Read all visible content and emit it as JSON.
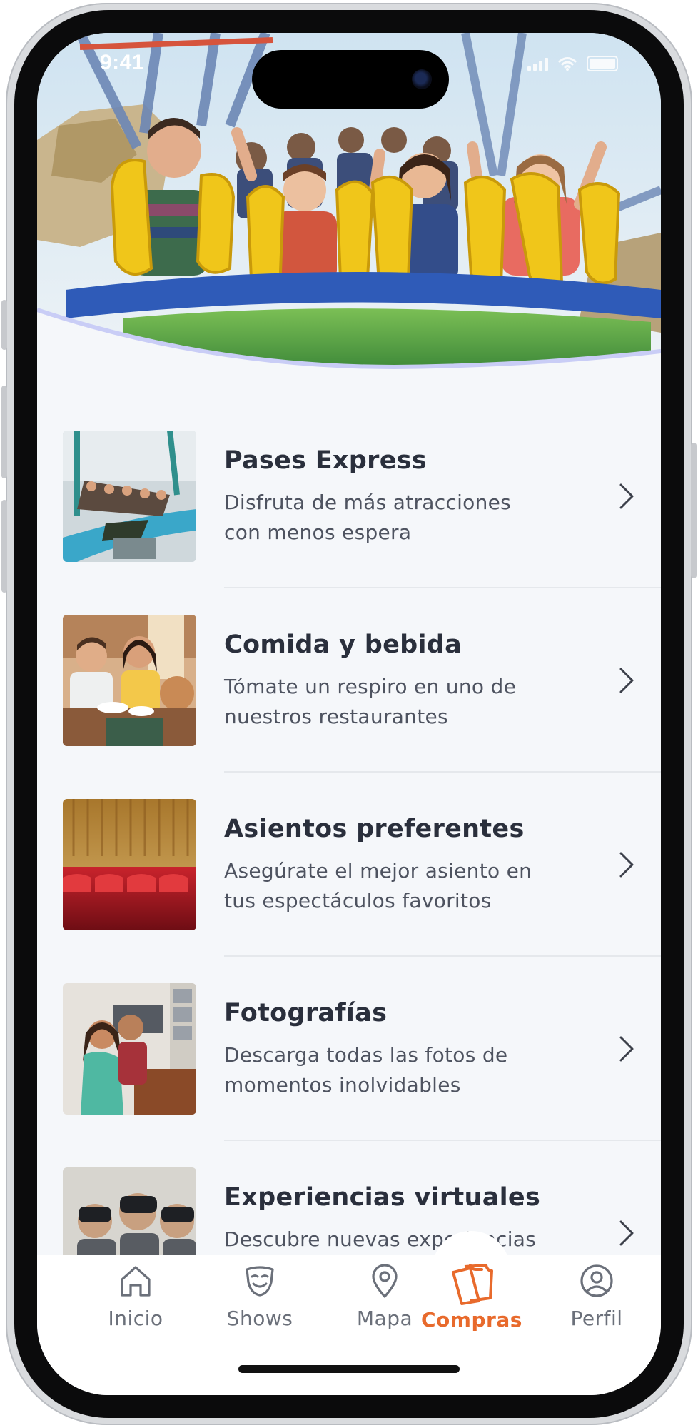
{
  "status_bar": {
    "time": "9:41"
  },
  "hero": {
    "image": "roller-coaster-riders-photo"
  },
  "items": [
    {
      "title": "Pases Express",
      "description": "Disfruta de más atracciones con menos espera",
      "thumb": "coaster-thumb"
    },
    {
      "title": "Comida y bebida",
      "description": "Tómate un respiro en uno de nuestros restaurantes",
      "thumb": "family-dinner-thumb"
    },
    {
      "title": "Asientos preferentes",
      "description": "Asegúrate el mejor asiento en tus espectáculos favoritos",
      "thumb": "theater-seats-thumb"
    },
    {
      "title": "Fotografías",
      "description": "Descarga todas las fotos de momentos inolvidables",
      "thumb": "photo-shop-thumb"
    },
    {
      "title": "Experiencias virtuales",
      "description": "Descubre nuevas experiencias",
      "thumb": "vr-headset-thumb"
    }
  ],
  "tabs": [
    {
      "label": "Inicio",
      "icon": "home-icon",
      "active": false
    },
    {
      "label": "Shows",
      "icon": "theater-mask-icon",
      "active": false
    },
    {
      "label": "Mapa",
      "icon": "map-pin-icon",
      "active": false
    },
    {
      "label": "Compras",
      "icon": "tickets-icon",
      "active": true
    },
    {
      "label": "Perfil",
      "icon": "user-icon",
      "active": false
    }
  ],
  "colors": {
    "accent": "#e86a2c",
    "title_text": "#2a2f3c",
    "body_text": "#4e5360",
    "background": "#f5f7fa"
  }
}
